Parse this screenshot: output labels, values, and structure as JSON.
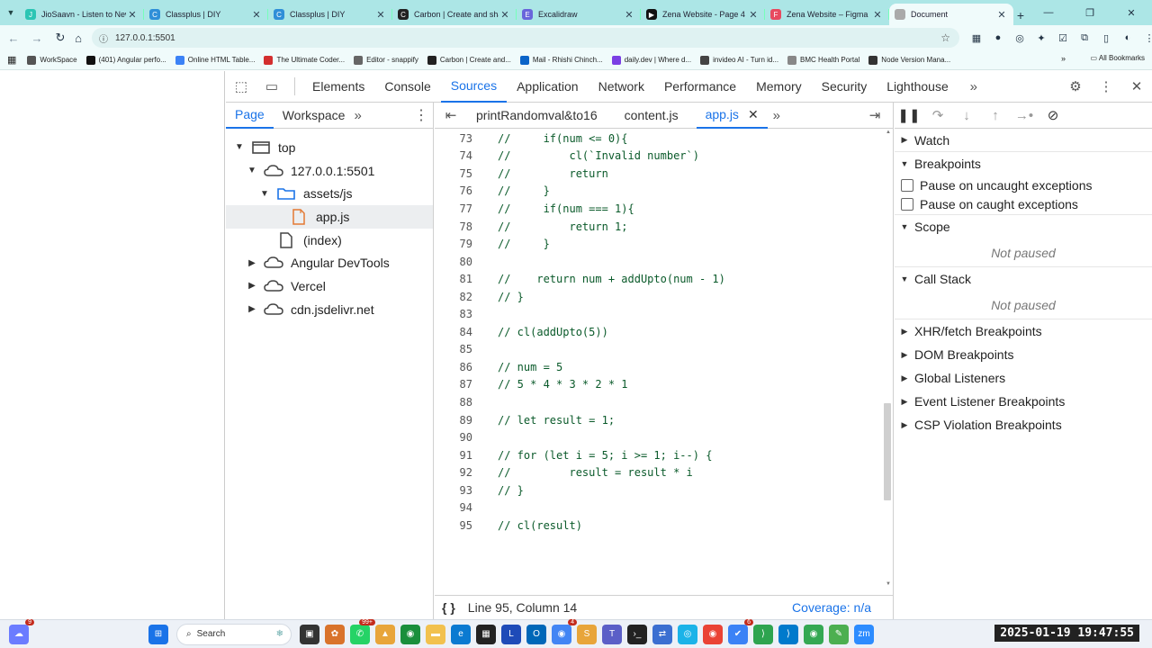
{
  "browser": {
    "tabs": [
      {
        "title": "JioSaavn - Listen to New",
        "color": "#2bc5b4",
        "glyph": "J"
      },
      {
        "title": "Classplus | DIY",
        "color": "#2f8fd8",
        "glyph": "C"
      },
      {
        "title": "Classplus | DIY",
        "color": "#2f8fd8",
        "glyph": "C"
      },
      {
        "title": "Carbon | Create and shar",
        "color": "#222222",
        "glyph": "C"
      },
      {
        "title": "Excalidraw",
        "color": "#6965db",
        "glyph": "E"
      },
      {
        "title": "Zena Website - Page 4",
        "color": "#111111",
        "glyph": "▶"
      },
      {
        "title": "Zena Website – Figma",
        "color": "#e84a5f",
        "glyph": "F"
      },
      {
        "title": "Document",
        "color": "#aaaaaa",
        "glyph": ""
      }
    ],
    "active_tab": 7,
    "url": "127.0.0.1:5501",
    "bookmarks": [
      {
        "label": "WorkSpace",
        "color": "#555555"
      },
      {
        "label": "(401) Angular perfo...",
        "color": "#111111"
      },
      {
        "label": "Online HTML Table...",
        "color": "#3b82f6"
      },
      {
        "label": "The Ultimate Coder...",
        "color": "#d32f2f"
      },
      {
        "label": "Editor - snappify",
        "color": "#666666"
      },
      {
        "label": "Carbon | Create and...",
        "color": "#222222"
      },
      {
        "label": "Mail - Rhishi Chinch...",
        "color": "#0a64c8"
      },
      {
        "label": "daily.dev | Where d...",
        "color": "#7b3fe4"
      },
      {
        "label": "invideo AI - Turn id...",
        "color": "#444444"
      },
      {
        "label": "BMC Health Portal",
        "color": "#888888"
      },
      {
        "label": "Node Version Mana...",
        "color": "#333333"
      }
    ],
    "all_bookmarks": "All Bookmarks"
  },
  "devtools": {
    "tabs": [
      "Elements",
      "Console",
      "Sources",
      "Application",
      "Network",
      "Performance",
      "Memory",
      "Security",
      "Lighthouse"
    ],
    "active_tab": "Sources",
    "navigator": {
      "tabs": [
        "Page",
        "Workspace"
      ],
      "tree": [
        {
          "label": "top",
          "indent": 0,
          "arrow": "▼",
          "icon": "frame"
        },
        {
          "label": "127.0.0.1:5501",
          "indent": 1,
          "arrow": "▼",
          "icon": "cloud"
        },
        {
          "label": "assets/js",
          "indent": 2,
          "arrow": "▼",
          "icon": "folder"
        },
        {
          "label": "app.js",
          "indent": 3,
          "arrow": "",
          "icon": "jsfile",
          "selected": true
        },
        {
          "label": "(index)",
          "indent": 2,
          "arrow": "",
          "icon": "file"
        },
        {
          "label": "Angular DevTools",
          "indent": 1,
          "arrow": "▶",
          "icon": "cloud"
        },
        {
          "label": "Vercel",
          "indent": 1,
          "arrow": "▶",
          "icon": "cloud"
        },
        {
          "label": "cdn.jsdelivr.net",
          "indent": 1,
          "arrow": "▶",
          "icon": "cloud"
        }
      ]
    },
    "editor": {
      "tabs": [
        "printRandomval&to16",
        "content.js",
        "app.js"
      ],
      "active_tab": "app.js",
      "lines": [
        {
          "n": "73",
          "t": "//     if(num <= 0){"
        },
        {
          "n": "74",
          "t": "//         cl(`Invalid number`)"
        },
        {
          "n": "75",
          "t": "//         return"
        },
        {
          "n": "76",
          "t": "//     }"
        },
        {
          "n": "77",
          "t": "//     if(num === 1){"
        },
        {
          "n": "78",
          "t": "//         return 1;"
        },
        {
          "n": "79",
          "t": "//     }"
        },
        {
          "n": "80",
          "t": ""
        },
        {
          "n": "81",
          "t": "//    return num + addUpto(num - 1)"
        },
        {
          "n": "82",
          "t": "// }"
        },
        {
          "n": "83",
          "t": ""
        },
        {
          "n": "84",
          "t": "// cl(addUpto(5))"
        },
        {
          "n": "85",
          "t": ""
        },
        {
          "n": "86",
          "t": "// num = 5"
        },
        {
          "n": "87",
          "t": "// 5 * 4 * 3 * 2 * 1"
        },
        {
          "n": "88",
          "t": ""
        },
        {
          "n": "89",
          "t": "// let result = 1;"
        },
        {
          "n": "90",
          "t": ""
        },
        {
          "n": "91",
          "t": "// for (let i = 5; i >= 1; i--) {"
        },
        {
          "n": "92",
          "t": "//         result = result * i"
        },
        {
          "n": "93",
          "t": "// }"
        },
        {
          "n": "94",
          "t": ""
        },
        {
          "n": "95",
          "t": "// cl(result)"
        }
      ],
      "status": {
        "braces": "{ }",
        "position": "Line 95, Column 14",
        "coverage": "Coverage: n/a"
      }
    },
    "debugger": {
      "watch": "Watch",
      "breakpoints": "Breakpoints",
      "pause_uncaught": "Pause on uncaught exceptions",
      "pause_caught": "Pause on caught exceptions",
      "scope": "Scope",
      "scope_state": "Not paused",
      "call_stack": "Call Stack",
      "call_stack_state": "Not paused",
      "collapsed_sections": [
        "XHR/fetch Breakpoints",
        "DOM Breakpoints",
        "Global Listeners",
        "Event Listener Breakpoints",
        "CSP Violation Breakpoints"
      ]
    }
  },
  "taskbar": {
    "search": "Search",
    "clock": "2025-01-19 19:47:55",
    "badges": {
      "whatsapp": "99+",
      "chrome": "4",
      "copilot": "6"
    }
  }
}
